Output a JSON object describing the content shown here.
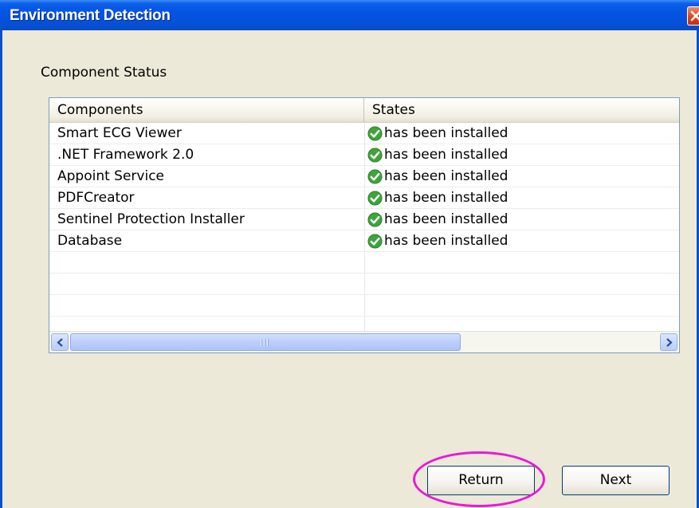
{
  "window": {
    "title": "Environment Detection"
  },
  "section_label": "Component Status",
  "table": {
    "columns": [
      "Components",
      "States"
    ],
    "rows": [
      {
        "name": "Smart ECG Viewer",
        "state": "has been installed"
      },
      {
        "name": ".NET Framework 2.0",
        "state": "has been installed"
      },
      {
        "name": "Appoint Service",
        "state": "has been installed"
      },
      {
        "name": "PDFCreator",
        "state": "has been installed"
      },
      {
        "name": "Sentinel Protection Installer",
        "state": "has been installed"
      },
      {
        "name": "Database",
        "state": "has been installed"
      }
    ],
    "state_icon": "green-check-icon"
  },
  "buttons": {
    "return_label": "Return",
    "next_label": "Next"
  },
  "colors": {
    "title_bar": "#0554e3",
    "highlight": "#e81ad6",
    "check": "#3fa43a"
  }
}
